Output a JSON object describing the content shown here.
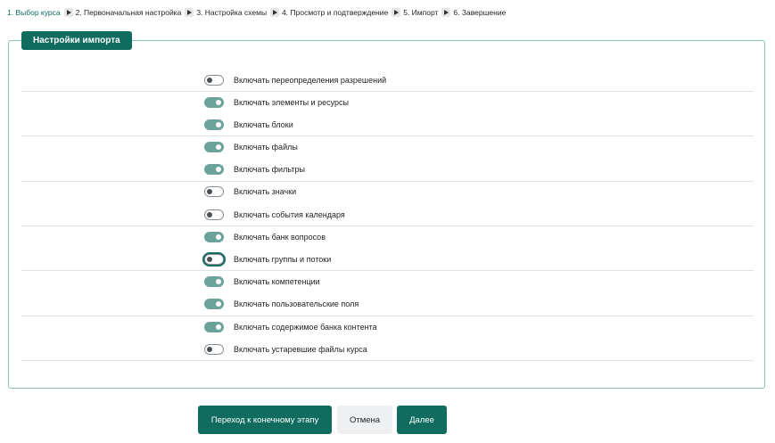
{
  "stepper": {
    "steps": [
      "1. Выбор курса",
      "2. Первоначальная настройка",
      "3. Настройка схемы",
      "4. Просмотр и подтверждение",
      "5. Импорт",
      "6. Завершение"
    ],
    "active_step": 1
  },
  "panel": {
    "legend": "Настройки импорта"
  },
  "settings": [
    {
      "label": "Включать переопределения разрешений",
      "enabled": false,
      "focused": false
    },
    {
      "label": "Включать элементы и ресурсы",
      "enabled": true,
      "focused": false
    },
    {
      "label": "Включать блоки",
      "enabled": true,
      "focused": false
    },
    {
      "label": "Включать файлы",
      "enabled": true,
      "focused": false
    },
    {
      "label": "Включать фильтры",
      "enabled": true,
      "focused": false
    },
    {
      "label": "Включать значки",
      "enabled": false,
      "focused": false
    },
    {
      "label": "Включать события календаря",
      "enabled": false,
      "focused": false
    },
    {
      "label": "Включать банк вопросов",
      "enabled": true,
      "focused": false
    },
    {
      "label": "Включать группы и потоки",
      "enabled": false,
      "focused": true
    },
    {
      "label": "Включать компетенции",
      "enabled": true,
      "focused": false
    },
    {
      "label": "Включать пользовательские поля",
      "enabled": true,
      "focused": false
    },
    {
      "label": "Включать содержимое банка контента",
      "enabled": true,
      "focused": false
    },
    {
      "label": "Включать устаревшие файлы курса",
      "enabled": false,
      "focused": false
    }
  ],
  "buttons": {
    "jump_to_final": "Переход к конечному этапу",
    "cancel": "Отмена",
    "next": "Далее"
  },
  "colors": {
    "accent": "#0f6c5f",
    "toggle_on": "#6ba39a",
    "panel_border": "#8fbfb6"
  }
}
